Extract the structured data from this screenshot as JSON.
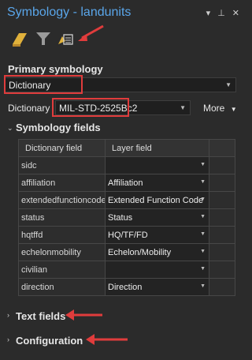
{
  "window": {
    "title": "Symbology - landunits",
    "controls": [
      "▾",
      "⊥",
      "✕"
    ]
  },
  "toolbar": {
    "icons": [
      "primary-symbology-icon",
      "vary-symbology-icon",
      "symbol-layer-drawing-icon"
    ]
  },
  "primary": {
    "heading": "Primary symbology",
    "value": "Dictionary"
  },
  "dictionary": {
    "label": "Dictionary",
    "value": "MIL-STD-2525Bc2",
    "more_label": "More"
  },
  "symbology_fields": {
    "heading": "Symbology fields",
    "columns": [
      "Dictionary field",
      "Layer field"
    ],
    "rows": [
      {
        "field": "sidc",
        "layer": ""
      },
      {
        "field": "affiliation",
        "layer": "Affiliation"
      },
      {
        "field": "extendedfunctioncode",
        "layer": "Extended Function Code"
      },
      {
        "field": "status",
        "layer": "Status"
      },
      {
        "field": "hqtffd",
        "layer": "HQ/TF/FD"
      },
      {
        "field": "echelonmobility",
        "layer": "Echelon/Mobility"
      },
      {
        "field": "civilian",
        "layer": ""
      },
      {
        "field": "direction",
        "layer": "Direction"
      }
    ]
  },
  "text_fields": {
    "heading": "Text fields"
  },
  "configuration": {
    "heading": "Configuration"
  },
  "colors": {
    "accent": "#5aa6ea",
    "highlight": "#e03c3c",
    "background": "#2b2b2b"
  }
}
